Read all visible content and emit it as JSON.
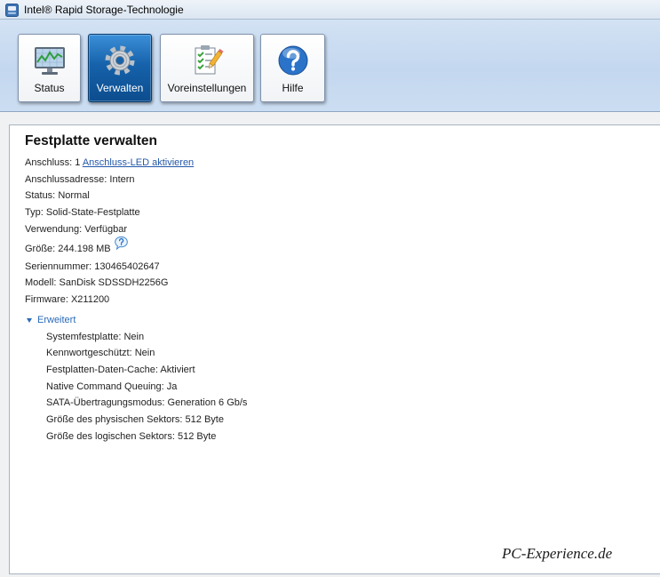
{
  "window": {
    "title": "Intel® Rapid Storage-Technologie",
    "icon": "intel-rst-app-icon"
  },
  "toolbar": {
    "buttons": [
      {
        "label": "Status",
        "icon": "status-monitor-icon",
        "selected": false
      },
      {
        "label": "Verwalten",
        "icon": "gear-icon",
        "selected": true
      },
      {
        "label": "Voreinstellungen",
        "icon": "preferences-checklist-icon",
        "selected": false
      },
      {
        "label": "Hilfe",
        "icon": "help-icon",
        "selected": false
      }
    ]
  },
  "main": {
    "heading": "Festplatte verwalten",
    "port": {
      "label": "Anschluss:",
      "value": "1",
      "link": "Anschluss-LED aktivieren"
    },
    "properties": [
      {
        "label": "Anschlussadresse:",
        "value": "Intern"
      },
      {
        "label": "Status:",
        "value": "Normal"
      },
      {
        "label": "Typ:",
        "value": "Solid-State-Festplatte"
      },
      {
        "label": "Verwendung:",
        "value": "Verfügbar"
      },
      {
        "label": "Größe:",
        "value": "244.198 MB"
      },
      {
        "label": "Seriennummer:",
        "value": "130465402647"
      },
      {
        "label": "Modell:",
        "value": "SanDisk SDSSDH2256G"
      },
      {
        "label": "Firmware:",
        "value": "X211200"
      }
    ],
    "size_help_icon": "help-bubble-icon",
    "advanced": {
      "toggle_label": "Erweitert",
      "expanded": true,
      "icon": "expand-arrow-icon",
      "properties": [
        {
          "label": "Systemfestplatte:",
          "value": "Nein"
        },
        {
          "label": "Kennwortgeschützt:",
          "value": "Nein"
        },
        {
          "label": "Festplatten-Daten-Cache:",
          "value": "Aktiviert"
        },
        {
          "label": "Native Command Queuing:",
          "value": "Ja"
        },
        {
          "label": "SATA-Übertragungsmodus:",
          "value": "Generation 6 Gb/s"
        },
        {
          "label": "Größe des physischen Sektors:",
          "value": "512 Byte"
        },
        {
          "label": "Größe des logischen Sektors:",
          "value": "512 Byte"
        }
      ]
    }
  },
  "watermark": "PC-Experience.de",
  "colors": {
    "selected_button": "#1662ab",
    "link": "#2458a8",
    "accent": "#2a6ab8",
    "status_graph": "#2e9e3e"
  }
}
